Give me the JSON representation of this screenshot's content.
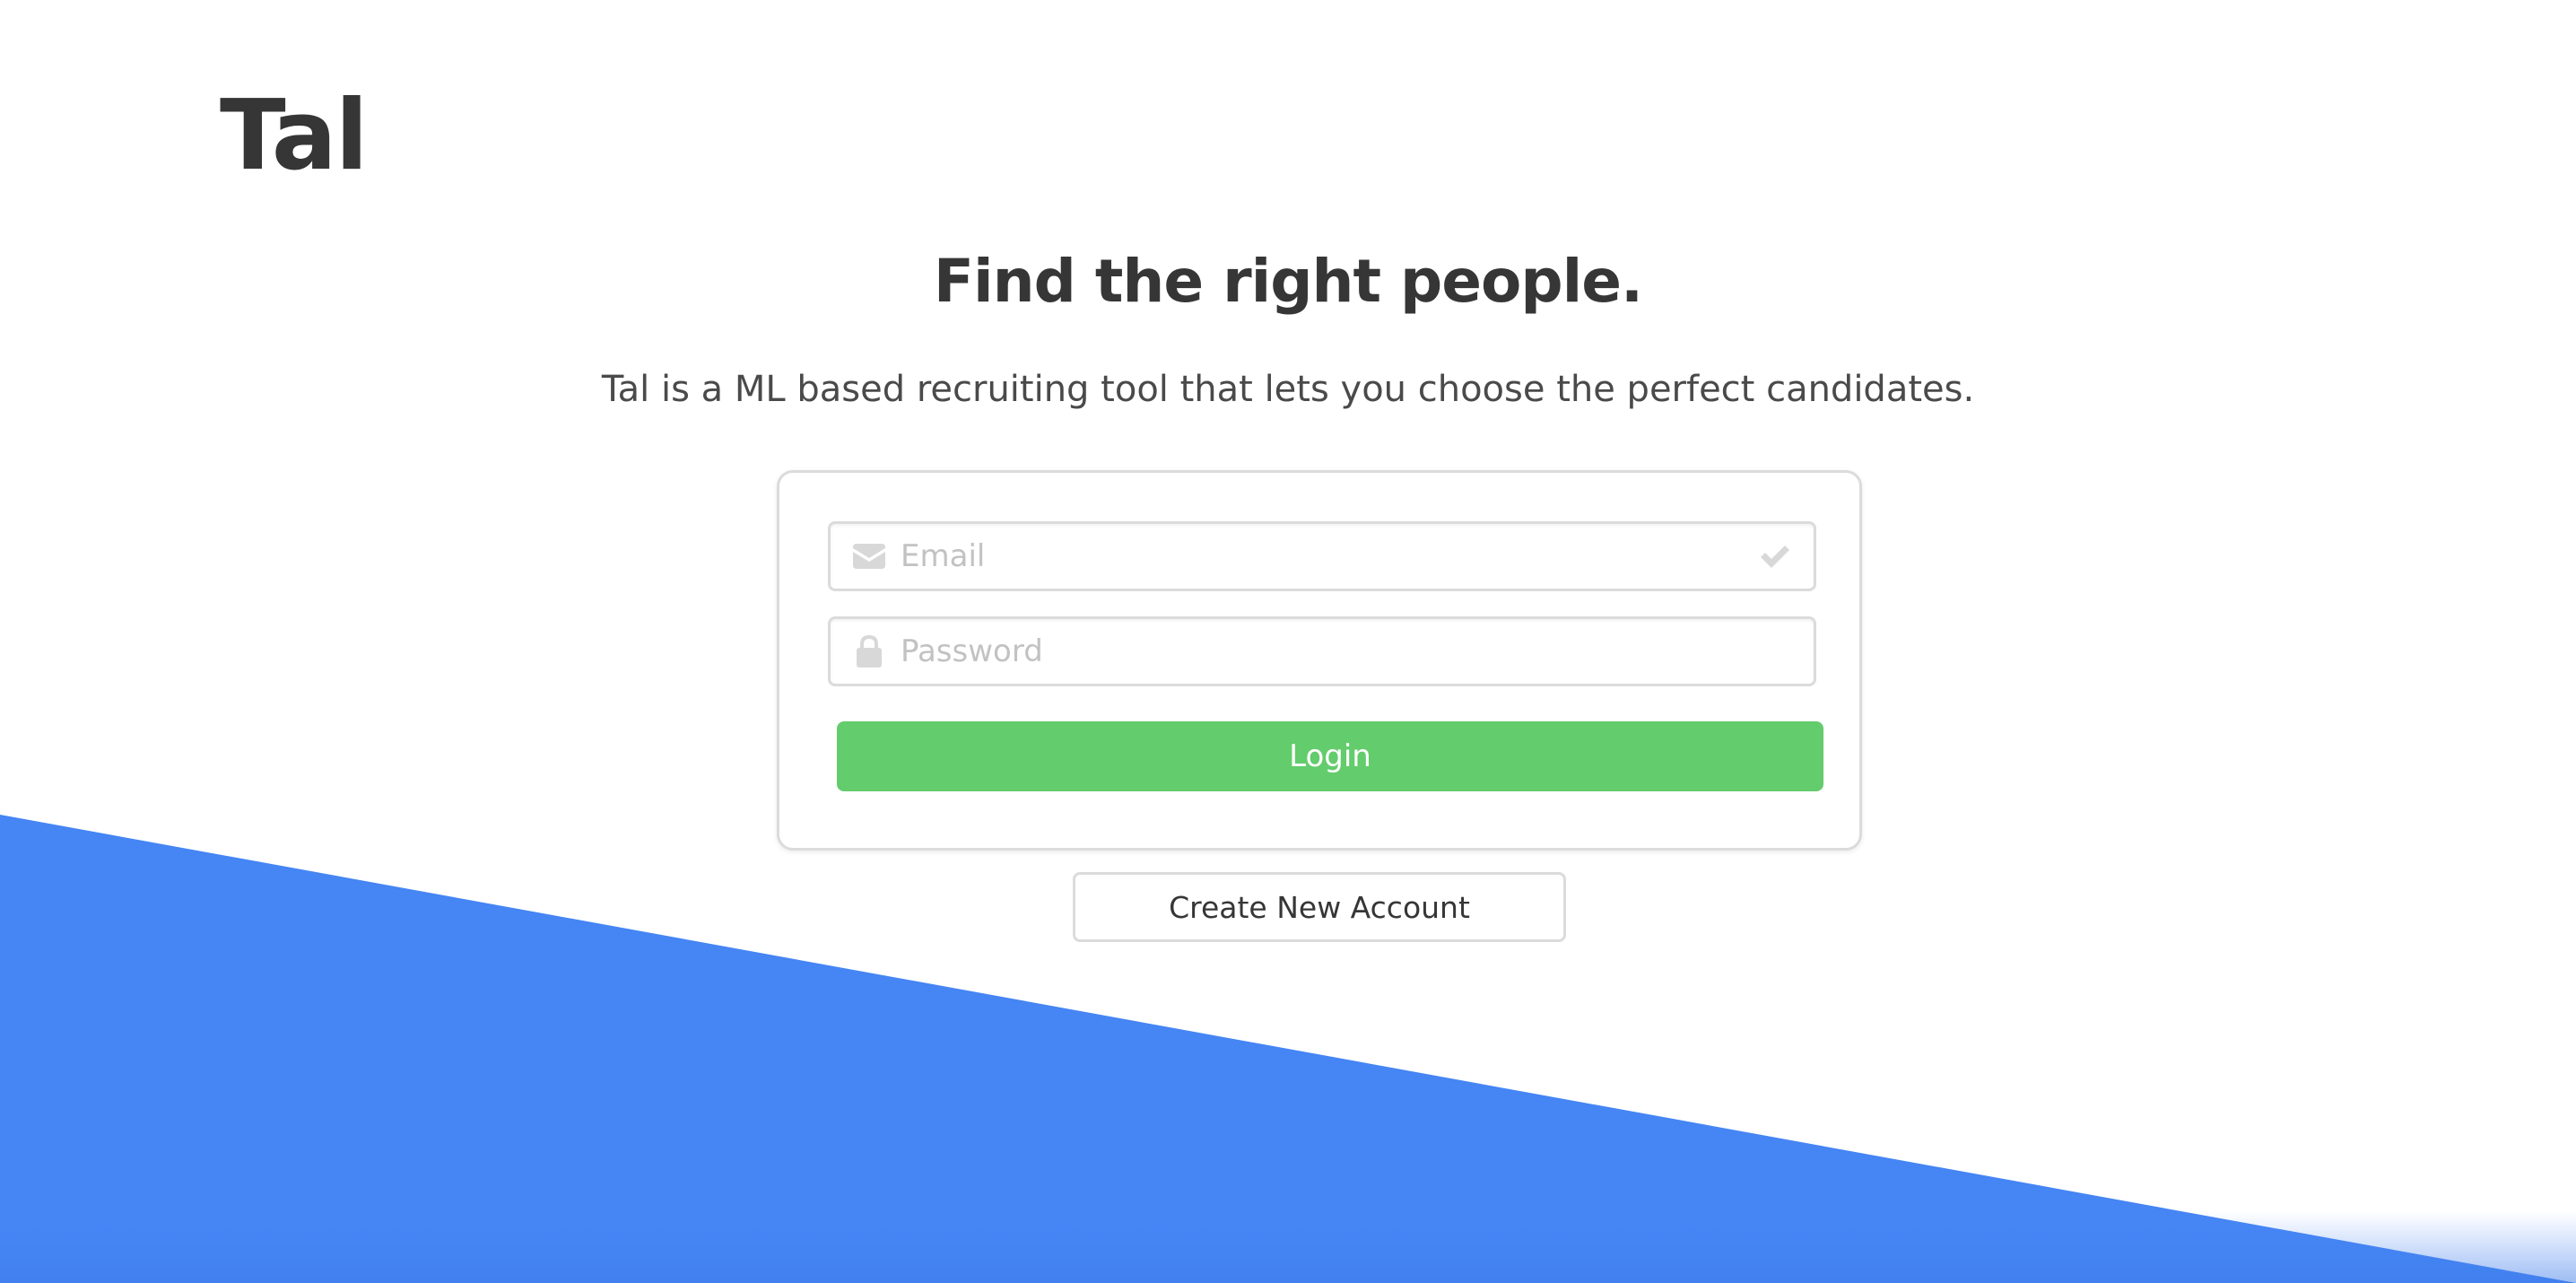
{
  "brand": {
    "logo_text": "Tal"
  },
  "hero": {
    "headline": "Find the right people.",
    "subline": "Tal is a ML based recruiting tool that lets you choose the perfect candidates."
  },
  "login_form": {
    "email": {
      "placeholder": "Email",
      "value": "",
      "left_icon": "envelope-icon",
      "right_icon": "check-icon"
    },
    "password": {
      "placeholder": "Password",
      "value": "",
      "left_icon": "lock-icon"
    },
    "login_label": "Login"
  },
  "create_account_label": "Create New Account",
  "colors": {
    "accent_blue": "#4585f4",
    "login_green": "#63cc6c",
    "text_dark": "#363636",
    "border_gray": "#dbdbdb",
    "icon_gray": "#d8d8d8"
  }
}
